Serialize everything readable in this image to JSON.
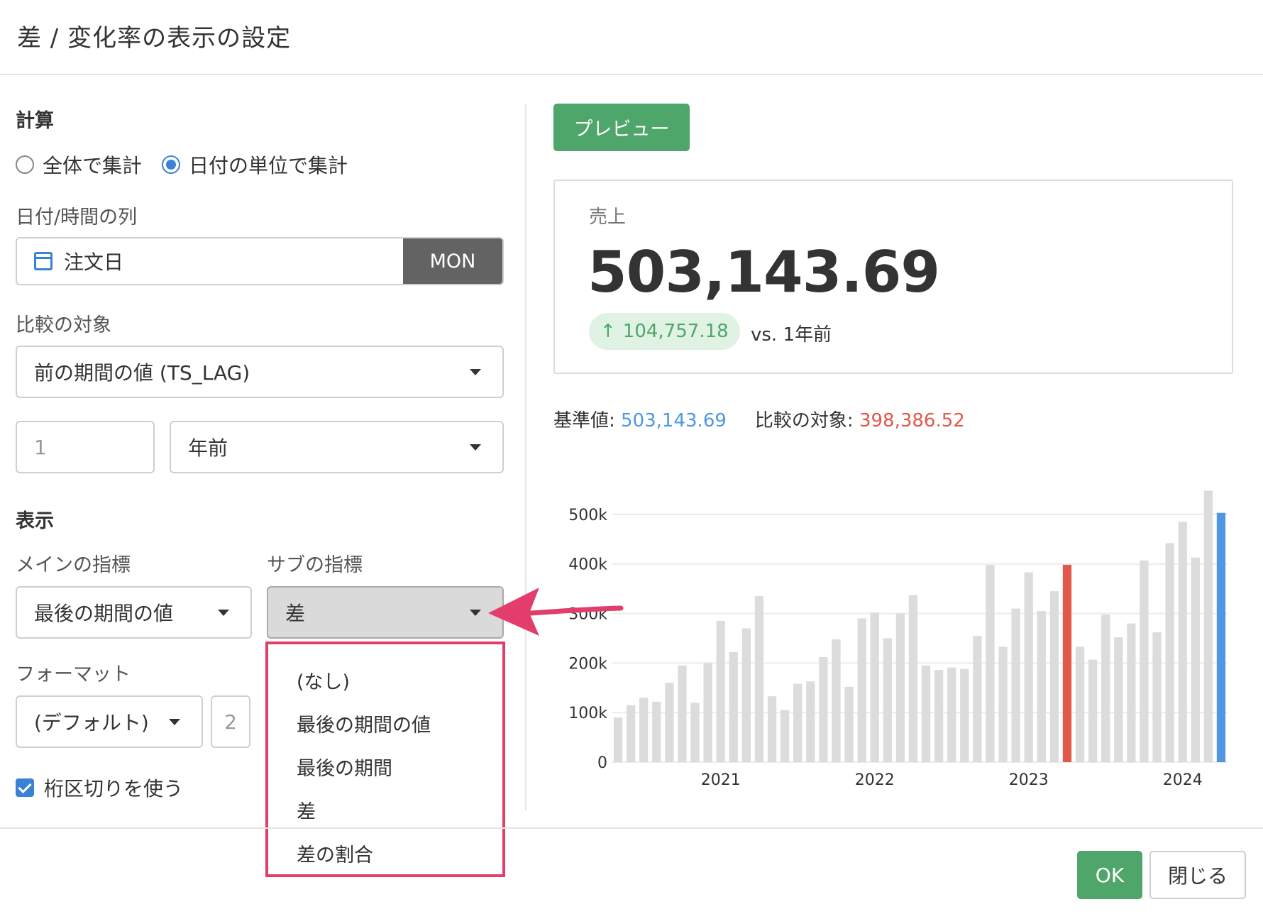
{
  "dialog": {
    "title": "差 / 変化率の表示の設定"
  },
  "calculation": {
    "section_label": "計算",
    "options": [
      "全体で集計",
      "日付の単位で集計"
    ],
    "selected_index": 1
  },
  "date_column": {
    "label": "日付/時間の列",
    "value": "注文日",
    "unit_button": "MON"
  },
  "comparison": {
    "label": "比較の対象",
    "value": "前の期間の値 (TS_LAG)",
    "offset_value": "1",
    "offset_unit": "年前"
  },
  "display": {
    "section_label": "表示",
    "main_metric_label": "メインの指標",
    "main_metric_value": "最後の期間の値",
    "sub_metric_label": "サブの指標",
    "sub_metric_value": "差",
    "sub_metric_options": [
      "(なし)",
      "最後の期間の値",
      "最後の期間",
      "差",
      "差の割合"
    ],
    "format_label": "フォーマット",
    "format_value": "(デフォルト)",
    "decimals_value": "2",
    "thousands_separator_label": "桁区切りを使う",
    "thousands_separator_checked": true
  },
  "preview": {
    "button_label": "プレビュー",
    "card_label": "売上",
    "card_value": "503,143.69",
    "delta_arrow": "↑",
    "delta_value": "104,757.18",
    "compare_text": "vs. 1年前",
    "base_label": "基準値: ",
    "base_value": "503,143.69",
    "compare_label": "比較の対象: ",
    "compare_value": "398,386.52"
  },
  "footer": {
    "ok_label": "OK",
    "close_label": "閉じる"
  },
  "colors": {
    "accent_green": "#4fa66a",
    "accent_blue": "#4f97e3",
    "highlight_red": "#e0594b",
    "bar_gray": "#dcdcdc",
    "annotation_pink": "#e23d6b"
  },
  "chart_data": {
    "type": "bar",
    "title": "",
    "xlabel": "",
    "ylabel": "",
    "ylim": [
      0,
      550000
    ],
    "y_ticks": [
      0,
      100000,
      200000,
      300000,
      400000,
      500000
    ],
    "y_tick_labels": [
      "0",
      "100k",
      "200k",
      "300k",
      "400k",
      "500k"
    ],
    "x_tick_labels": [
      "2021",
      "2022",
      "2023",
      "2024"
    ],
    "x_tick_indices": [
      8,
      20,
      32,
      44
    ],
    "values": [
      90000,
      115000,
      130000,
      122000,
      160000,
      195000,
      120000,
      200000,
      285000,
      222000,
      270000,
      335000,
      133000,
      105000,
      158000,
      163000,
      212000,
      248000,
      152000,
      290000,
      302000,
      250000,
      300000,
      337000,
      195000,
      186000,
      191000,
      188000,
      255000,
      398000,
      233000,
      310000,
      383000,
      305000,
      345000,
      398386.52,
      233000,
      207000,
      298000,
      252000,
      280000,
      407000,
      262000,
      442000,
      485000,
      413000,
      548000,
      503143.69
    ],
    "highlight": {
      "comparison_index": 35,
      "base_index": 47
    },
    "grid": true
  }
}
